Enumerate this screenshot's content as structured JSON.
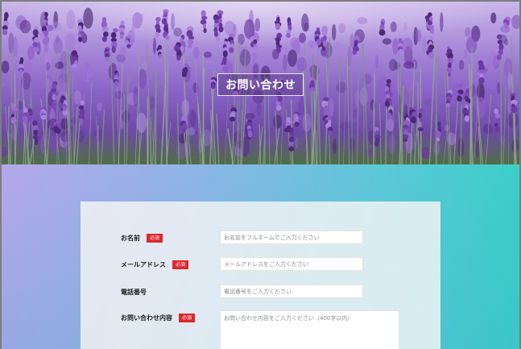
{
  "hero": {
    "title": "お問い合わせ"
  },
  "form": {
    "fields": [
      {
        "label": "お名前",
        "required": true,
        "required_label": "必須",
        "placeholder": "お名前をフルネームでご入力ください"
      },
      {
        "label": "メールアドレス",
        "required": true,
        "required_label": "必須",
        "placeholder": "メールアドレスをご入力ください"
      },
      {
        "label": "電話番号",
        "required": false,
        "required_label": "",
        "placeholder": "電話番号をご入力ください"
      },
      {
        "label": "お問い合わせ内容",
        "required": true,
        "required_label": "必須",
        "placeholder": "お問い合わせ内容をご入力ください（400字以内）"
      }
    ]
  },
  "colors": {
    "required_badge": "#e0262b",
    "gradient_start": "#b6a6ea",
    "gradient_end": "#34d0c4",
    "lavender": "#8a63c7"
  }
}
